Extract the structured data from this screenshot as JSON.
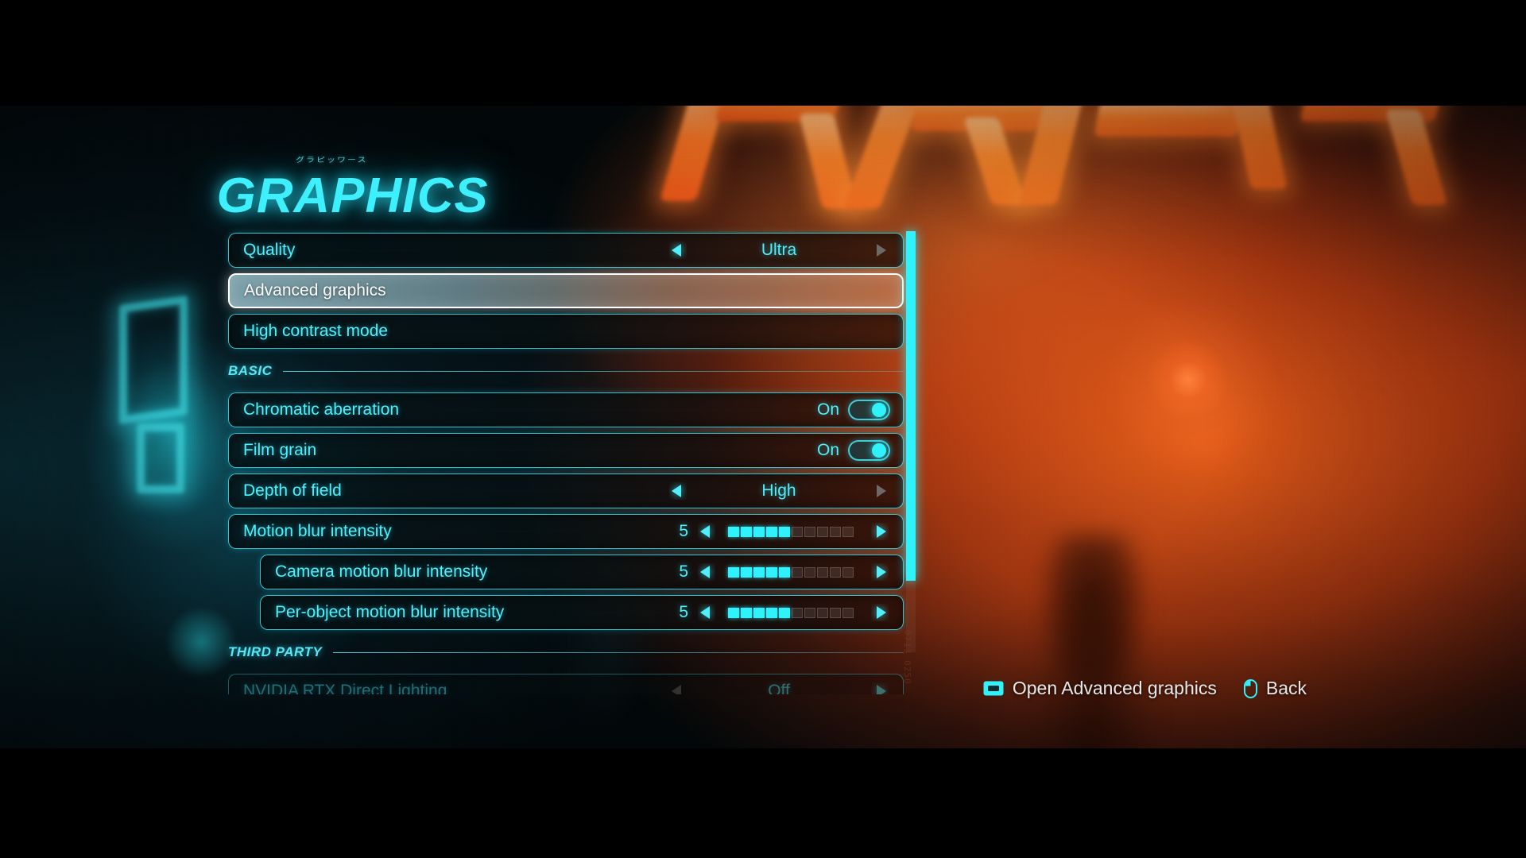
{
  "screen": {
    "title": "GRAPHICS",
    "title_deco": "グラピッワース",
    "accent_color": "#3ef0fb",
    "selected_color": "#ffffff",
    "background_warm": "#ff6a18"
  },
  "scroll": {
    "deco_text": "0713 0250",
    "thumb_position_pct": 0
  },
  "options": [
    {
      "kind": "selector",
      "name": "quality",
      "label": "Quality",
      "value": "Ultra",
      "left_arrow": "active",
      "right_arrow": "disabled",
      "indent": false,
      "selected": false
    },
    {
      "kind": "action",
      "name": "advanced-graphics",
      "label": "Advanced graphics",
      "indent": false,
      "selected": true
    },
    {
      "kind": "action",
      "name": "high-contrast-mode",
      "label": "High contrast mode",
      "indent": false,
      "selected": false
    }
  ],
  "sections": [
    {
      "name": "basic",
      "header": "BASIC",
      "options": [
        {
          "kind": "toggle",
          "name": "chromatic-aberration",
          "label": "Chromatic aberration",
          "value": "On",
          "state": "on",
          "indent": false
        },
        {
          "kind": "toggle",
          "name": "film-grain",
          "label": "Film grain",
          "value": "On",
          "state": "on",
          "indent": false
        },
        {
          "kind": "selector",
          "name": "depth-of-field",
          "label": "Depth of field",
          "value": "High",
          "left_arrow": "active",
          "right_arrow": "disabled",
          "indent": false
        },
        {
          "kind": "slider",
          "name": "motion-blur-intensity",
          "label": "Motion blur intensity",
          "value": "5",
          "filled": 5,
          "total": 10,
          "left_arrow": "active",
          "right_arrow": "active",
          "indent": false
        },
        {
          "kind": "slider",
          "name": "camera-motion-blur-intensity",
          "label": "Camera motion blur intensity",
          "value": "5",
          "filled": 5,
          "total": 10,
          "left_arrow": "active",
          "right_arrow": "active",
          "indent": true
        },
        {
          "kind": "slider",
          "name": "per-object-motion-blur-intensity",
          "label": "Per-object motion blur intensity",
          "value": "5",
          "filled": 5,
          "total": 10,
          "left_arrow": "active",
          "right_arrow": "active",
          "indent": true
        }
      ]
    },
    {
      "name": "third-party",
      "header": "THIRD PARTY",
      "options": [
        {
          "kind": "selector",
          "name": "nvidia-rtx-direct-lighting",
          "label": "NVIDIA RTX Direct Lighting",
          "value": "Off",
          "left_arrow": "disabled",
          "right_arrow": "active",
          "indent": false,
          "clipped": true
        }
      ]
    }
  ],
  "footer": {
    "prompts": [
      {
        "name": "open-advanced-graphics",
        "icon": "enter-key-icon",
        "label": "Open Advanced graphics"
      },
      {
        "name": "back",
        "icon": "mouse-left-click-icon",
        "label": "Back"
      }
    ]
  }
}
